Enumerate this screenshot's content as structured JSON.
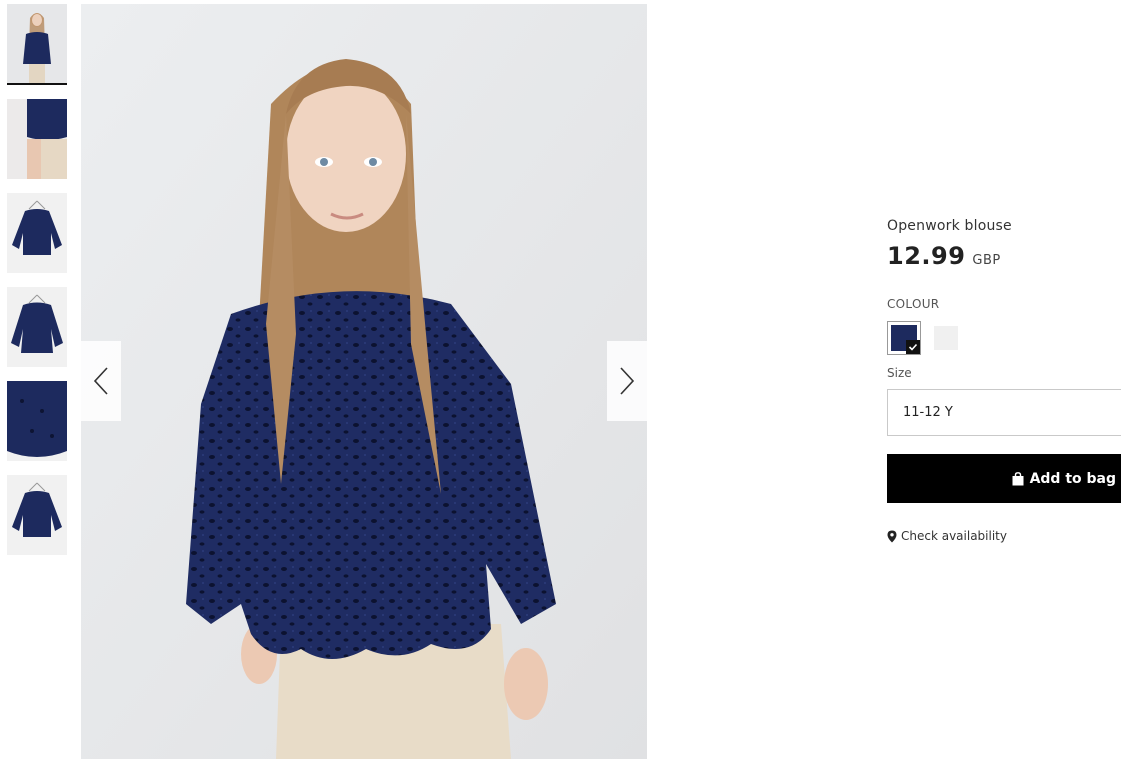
{
  "gallery": {
    "thumbnails": [
      {
        "alt": "Model front view"
      },
      {
        "alt": "Detail close-up"
      },
      {
        "alt": "Product on hanger front"
      },
      {
        "alt": "Product on hanger angle"
      },
      {
        "alt": "Fabric detail"
      },
      {
        "alt": "Product on hanger back"
      }
    ],
    "active_index": 0
  },
  "product": {
    "name": "Openwork blouse",
    "price": "12.99",
    "currency": "GBP",
    "colour_label": "COLOUR",
    "colours": [
      {
        "hex": "#1d2a5e",
        "selected": true
      },
      {
        "hex": "#f2f2f2",
        "selected": false
      }
    ],
    "size_label": "Size",
    "size_value": "11-12 Y",
    "add_to_bag_label": "Add to bag",
    "check_availability_label": "Check availability"
  },
  "colors": {
    "blouse_navy": "#1d2a5e",
    "button_black": "#000000",
    "background": "#ffffff"
  }
}
